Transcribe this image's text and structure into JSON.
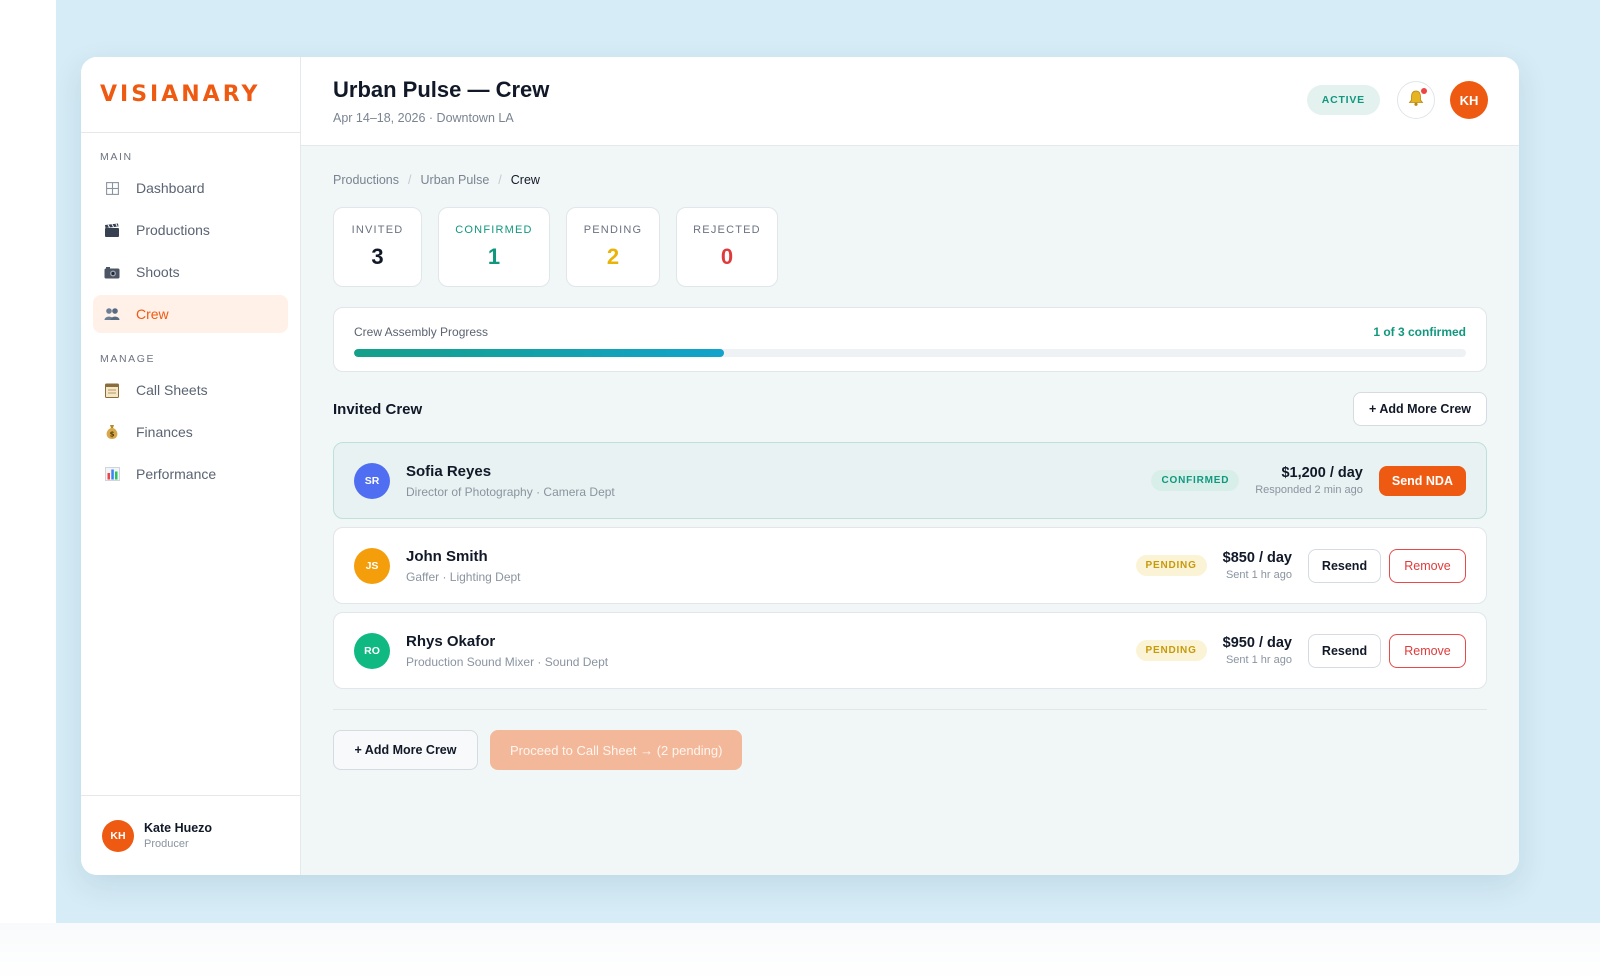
{
  "app": {
    "logo": "VISIANARY"
  },
  "sidebar": {
    "sections": [
      {
        "label": "MAIN"
      },
      {
        "label": "MANAGE"
      }
    ],
    "items": [
      {
        "label": "Dashboard",
        "icon": "grid-icon"
      },
      {
        "label": "Productions",
        "icon": "clapperboard-icon"
      },
      {
        "label": "Shoots",
        "icon": "camera-icon"
      },
      {
        "label": "Crew",
        "icon": "people-icon",
        "active": true
      },
      {
        "label": "Call Sheets",
        "icon": "notepad-icon"
      },
      {
        "label": "Finances",
        "icon": "money-bag-icon"
      },
      {
        "label": "Performance",
        "icon": "bar-chart-icon"
      }
    ],
    "user": {
      "initials": "KH",
      "name": "Kate Huezo",
      "role": "Producer"
    }
  },
  "header": {
    "title": "Urban Pulse — Crew",
    "subtitle": "Apr 14–18, 2026 · Downtown LA",
    "status": "ACTIVE",
    "avatar_initials": "KH"
  },
  "breadcrumb": [
    "Productions",
    "Urban Pulse",
    "Crew"
  ],
  "stats": [
    {
      "label": "INVITED",
      "value": "3",
      "color": "#111827"
    },
    {
      "label": "CONFIRMED",
      "value": "1",
      "color": "#12977f"
    },
    {
      "label": "PENDING",
      "value": "2",
      "color": "#eab308"
    },
    {
      "label": "REJECTED",
      "value": "0",
      "color": "#e03b3b"
    }
  ],
  "progress": {
    "label": "Crew Assembly Progress",
    "count_text": "1 of 3 confirmed",
    "fraction": 0.333
  },
  "invited_crew": {
    "title": "Invited Crew",
    "add_button": "+ Add More Crew",
    "rows": [
      {
        "initials": "SR",
        "avatar_color": "#4f6ef2",
        "name": "Sofia Reyes",
        "role": "Director of Photography · Camera Dept",
        "status": "CONFIRMED",
        "rate": "$1,200 / day",
        "sub": "Responded 2 min ago",
        "action": "Send NDA"
      },
      {
        "initials": "JS",
        "avatar_color": "#f59e0b",
        "name": "John Smith",
        "role": "Gaffer · Lighting Dept",
        "status": "PENDING",
        "rate": "$850 / day",
        "sub": "Sent 1 hr ago",
        "resend": "Resend",
        "remove": "Remove"
      },
      {
        "initials": "RO",
        "avatar_color": "#10b981",
        "name": "Rhys Okafor",
        "role": "Production Sound Mixer · Sound Dept",
        "status": "PENDING",
        "rate": "$950 / day",
        "sub": "Sent 1 hr ago",
        "resend": "Resend",
        "remove": "Remove"
      }
    ]
  },
  "footer_actions": {
    "add": "+ Add More Crew",
    "proceed": "Proceed to Call Sheet → (2 pending)"
  },
  "colors": {
    "brand": "#ee5a11",
    "accent": "#12977f",
    "pending": "#c79a0a",
    "danger": "#e03b3b"
  }
}
